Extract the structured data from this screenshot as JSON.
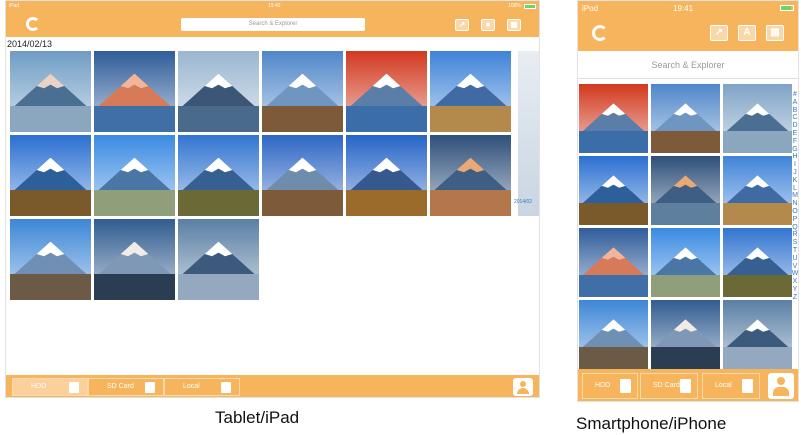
{
  "tablet": {
    "status": {
      "left": "iPad",
      "time": "19:42",
      "right": "100%"
    },
    "search_placeholder": "Search & Explorer",
    "nav_buttons": [
      {
        "name": "share-button",
        "glyph": "↗"
      },
      {
        "name": "sort-button",
        "glyph": "■"
      },
      {
        "name": "grid-view-button",
        "glyph": "▦"
      }
    ],
    "date_label": "2014/02/13",
    "edge_label": "2014/02",
    "photos": [
      {
        "sky": "#6f9cc4",
        "mtn": "#4a6f93",
        "fg": "#8aa7bf",
        "snow": "#e9d3c6"
      },
      {
        "sky": "#2f5c9a",
        "mtn": "#d67a5a",
        "fg": "#3f6fa6",
        "snow": "#f0b59a"
      },
      {
        "sky": "#9ab6d0",
        "mtn": "#3c5678",
        "fg": "#4a6a8c",
        "snow": "#ffffff"
      },
      {
        "sky": "#4f86c9",
        "mtn": "#6e96c0",
        "fg": "#7c5a3a",
        "snow": "#ffffff"
      },
      {
        "sky": "#d2391f",
        "mtn": "#5b7ea8",
        "fg": "#3b6ea8",
        "snow": "#ffffff"
      },
      {
        "sky": "#3f83d8",
        "mtn": "#3f6aa3",
        "fg": "#b48a4c",
        "snow": "#ffffff"
      },
      {
        "sky": "#2b6fd1",
        "mtn": "#2d5f9a",
        "fg": "#7a5a2b",
        "snow": "#ffffff"
      },
      {
        "sky": "#3a8ae2",
        "mtn": "#4a76a6",
        "fg": "#8f9f7a",
        "snow": "#ffffff"
      },
      {
        "sky": "#3275d0",
        "mtn": "#365f92",
        "fg": "#6b6a36",
        "snow": "#ffffff"
      },
      {
        "sky": "#2e66c4",
        "mtn": "#6f8cad",
        "fg": "#7d5a38",
        "snow": "#ffffff"
      },
      {
        "sky": "#2664c7",
        "mtn": "#35598e",
        "fg": "#9b6b2c",
        "snow": "#ffffff"
      },
      {
        "sky": "#2d4f79",
        "mtn": "#3e5f83",
        "fg": "#b4774b",
        "snow": "#e9a874"
      },
      {
        "sky": "#3d86d6",
        "mtn": "#6f8fb4",
        "fg": "#6b5a46",
        "snow": "#ffffff"
      },
      {
        "sky": "#305c8f",
        "mtn": "#7f98b5",
        "fg": "#2a3d52",
        "snow": "#f2ece6"
      },
      {
        "sky": "#5a7fa4",
        "mtn": "#3c5a7d",
        "fg": "#94a8bf",
        "snow": "#ffffff"
      }
    ],
    "toolbar": [
      {
        "label": "HDD",
        "selected": true
      },
      {
        "label": "SD Card",
        "selected": false
      },
      {
        "label": "Local",
        "selected": false
      }
    ]
  },
  "phone": {
    "status": {
      "left": "iPod",
      "time": "19:41"
    },
    "search_placeholder": "Search & Explorer",
    "nav_buttons": [
      {
        "name": "share-button",
        "glyph": "↗"
      },
      {
        "name": "sort-alpha-button",
        "glyph": "A"
      },
      {
        "name": "grid-view-button",
        "glyph": "▦"
      }
    ],
    "photos": [
      {
        "sky": "#d2391f",
        "mtn": "#5b7ea8",
        "fg": "#3b6ea8",
        "snow": "#ffffff"
      },
      {
        "sky": "#4f86c9",
        "mtn": "#6e96c0",
        "fg": "#7c5a3a",
        "snow": "#ffffff"
      },
      {
        "sky": "#7fa3c6",
        "mtn": "#4a6f93",
        "fg": "#8aa7bf",
        "snow": "#ffffff"
      },
      {
        "sky": "#2b6fd1",
        "mtn": "#2d5f9a",
        "fg": "#7a5a2b",
        "snow": "#ffffff"
      },
      {
        "sky": "#2d4f79",
        "mtn": "#3e5f83",
        "fg": "#5f7f9f",
        "snow": "#e9a874"
      },
      {
        "sky": "#3f83d8",
        "mtn": "#3f6aa3",
        "fg": "#b48a4c",
        "snow": "#ffffff"
      },
      {
        "sky": "#2f5c9a",
        "mtn": "#d67a5a",
        "fg": "#3f6fa6",
        "snow": "#f0b59a"
      },
      {
        "sky": "#3a8ae2",
        "mtn": "#4a76a6",
        "fg": "#8f9f7a",
        "snow": "#ffffff"
      },
      {
        "sky": "#3275d0",
        "mtn": "#365f92",
        "fg": "#6b6a36",
        "snow": "#ffffff"
      },
      {
        "sky": "#3d86d6",
        "mtn": "#6f8fb4",
        "fg": "#6b5a46",
        "snow": "#ffffff"
      },
      {
        "sky": "#305c8f",
        "mtn": "#7f98b5",
        "fg": "#2a3d52",
        "snow": "#f2ece6"
      },
      {
        "sky": "#5a7fa4",
        "mtn": "#3c5a7d",
        "fg": "#94a8bf",
        "snow": "#ffffff"
      }
    ],
    "alphabet": [
      "#",
      "A",
      "B",
      "C",
      "D",
      "E",
      "F",
      "G",
      "H",
      "I",
      "J",
      "K",
      "L",
      "M",
      "N",
      "O",
      "P",
      "Q",
      "R",
      "S",
      "T",
      "U",
      "V",
      "W",
      "X",
      "Y",
      "Z"
    ],
    "toolbar": [
      {
        "label": "HDD",
        "selected": true
      },
      {
        "label": "SD Card",
        "selected": false
      },
      {
        "label": "Local",
        "selected": false
      }
    ]
  },
  "captions": {
    "tablet": "Tablet/iPad",
    "phone": "Smartphone/iPhone"
  },
  "colors": {
    "accent": "#f6b45c",
    "index_link": "#3a78c2"
  }
}
